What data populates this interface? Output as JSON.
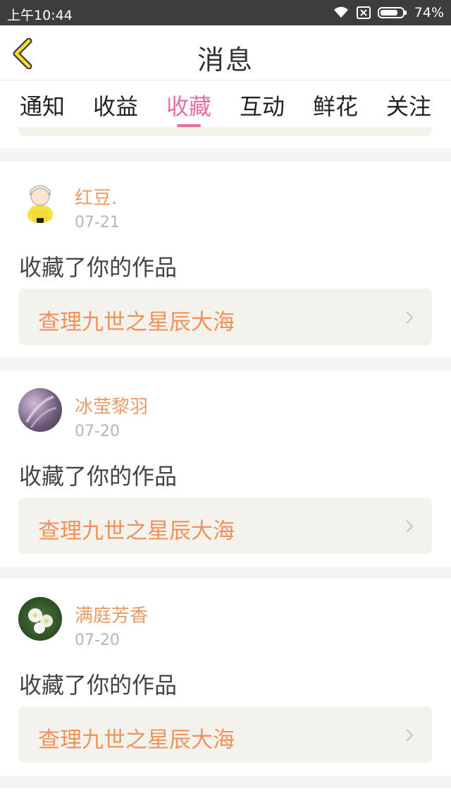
{
  "status": {
    "time": "上午10:44",
    "battery": "74%"
  },
  "nav": {
    "title": "消息"
  },
  "tabs": [
    {
      "label": "通知"
    },
    {
      "label": "收益"
    },
    {
      "label": "收藏"
    },
    {
      "label": "互动"
    },
    {
      "label": "鲜花"
    },
    {
      "label": "关注"
    }
  ],
  "active_tab": "收藏",
  "messages": [
    {
      "user": "红豆.",
      "date": "07-21",
      "action": "收藏了你的作品",
      "work": "查理九世之星辰大海"
    },
    {
      "user": "冰莹黎羽",
      "date": "07-20",
      "action": "收藏了你的作品",
      "work": "查理九世之星辰大海"
    },
    {
      "user": "满庭芳香",
      "date": "07-20",
      "action": "收藏了你的作品",
      "work": "查理九世之星辰大海"
    }
  ],
  "colors": {
    "accent": "#e56ea3",
    "username": "#eb9a63",
    "work_title": "#f0925a",
    "card_bg": "#f3f2ec"
  },
  "icons": [
    "wifi-icon",
    "sim-card-icon",
    "battery-icon",
    "back-arrow-icon",
    "chevron-right-icon"
  ]
}
